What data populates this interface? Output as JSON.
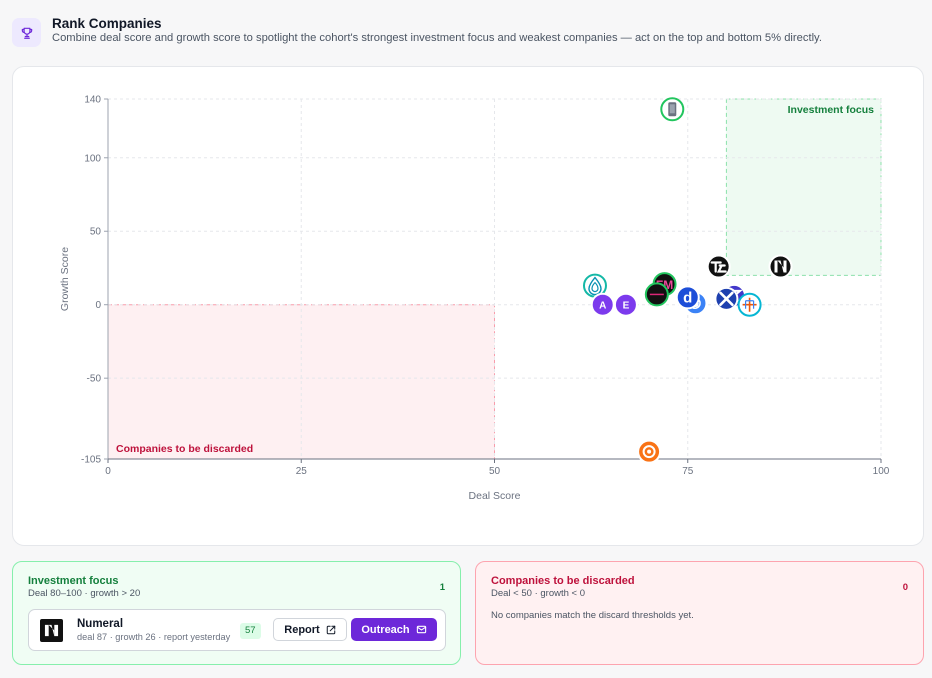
{
  "header": {
    "title": "Rank Companies",
    "subtitle": "Combine deal score and growth score to spotlight the cohort's strongest investment focus and weakest companies — act on the top and bottom 5% directly."
  },
  "colors": {
    "accent": "#6d28d9",
    "focus": "#15803d",
    "discard": "#be123c"
  },
  "chart_data": {
    "type": "scatter",
    "xlabel": "Deal Score",
    "ylabel": "Growth Score",
    "xlim": [
      0,
      100
    ],
    "ylim": [
      -105,
      140
    ],
    "xticks": [
      0,
      25,
      50,
      75,
      100
    ],
    "yticks": [
      -105,
      -50,
      0,
      50,
      100,
      140
    ],
    "grid": true,
    "regions": [
      {
        "label": "Investment focus",
        "x": [
          80,
          100
        ],
        "y": [
          20,
          140
        ],
        "color": "#22c55e"
      },
      {
        "label": "Companies to be discarded",
        "x": [
          0,
          50
        ],
        "y": [
          -105,
          0
        ],
        "color": "#f43f5e"
      }
    ],
    "points": [
      {
        "x": 73,
        "y": 133,
        "icon": "phone-logo-icon",
        "bg": "#ffffff",
        "ring": "#22c55e"
      },
      {
        "x": 87,
        "y": 26,
        "icon": "numeral-logo-icon",
        "bg": "#111111",
        "ring": "#ffffff"
      },
      {
        "x": 79,
        "y": 26,
        "icon": "tl-logo-icon",
        "bg": "#111111",
        "ring": "#ffffff"
      },
      {
        "x": 63,
        "y": 13,
        "icon": "water-drop-logo-icon",
        "bg": "#ffffff",
        "ring": "#14b8a6"
      },
      {
        "x": 72,
        "y": 14,
        "icon": "fm-logo-icon",
        "bg": "#111111",
        "ring": "#22c55e"
      },
      {
        "x": 71,
        "y": 7,
        "icon": "line-logo-icon",
        "bg": "#111111",
        "ring": "#22c55e"
      },
      {
        "x": 76,
        "y": 1,
        "icon": "swirl-logo-icon",
        "bg": "#3b82f6",
        "ring": "#ffffff"
      },
      {
        "x": 75,
        "y": 5,
        "icon": "d-logo-icon",
        "bg": "#1d4ed8",
        "ring": "#ffffff"
      },
      {
        "x": 81,
        "y": 6,
        "icon": "zendesk-logo-icon",
        "bg": "#4338ca",
        "ring": "#ffffff"
      },
      {
        "x": 80,
        "y": 4,
        "icon": "x-logo-icon",
        "bg": "#1e40af",
        "ring": "#ffffff"
      },
      {
        "x": 83,
        "y": 0,
        "icon": "plus-grid-logo-icon",
        "bg": "#ffffff",
        "ring": "#06b6d4"
      },
      {
        "x": 64,
        "y": 0,
        "letter": "A",
        "bg": "#7c3aed",
        "ring": "#ffffff"
      },
      {
        "x": 67,
        "y": 0,
        "letter": "E",
        "bg": "#7c3aed",
        "ring": "#ffffff"
      },
      {
        "x": 70,
        "y": -100,
        "icon": "orange-c-logo-icon",
        "bg": "#f97316",
        "ring": "#ffffff"
      }
    ]
  },
  "panels": {
    "focus": {
      "title": "Investment focus",
      "subtitle": "Deal 80–100 · growth > 20",
      "count": "1",
      "companies": [
        {
          "name": "Numeral",
          "meta": "deal 87 · growth 26 · report yesterday",
          "score": "57",
          "report_label": "Report",
          "outreach_label": "Outreach"
        }
      ]
    },
    "discard": {
      "title": "Companies to be discarded",
      "subtitle": "Deal < 50 · growth < 0",
      "count": "0",
      "empty_message": "No companies match the discard thresholds yet."
    }
  }
}
